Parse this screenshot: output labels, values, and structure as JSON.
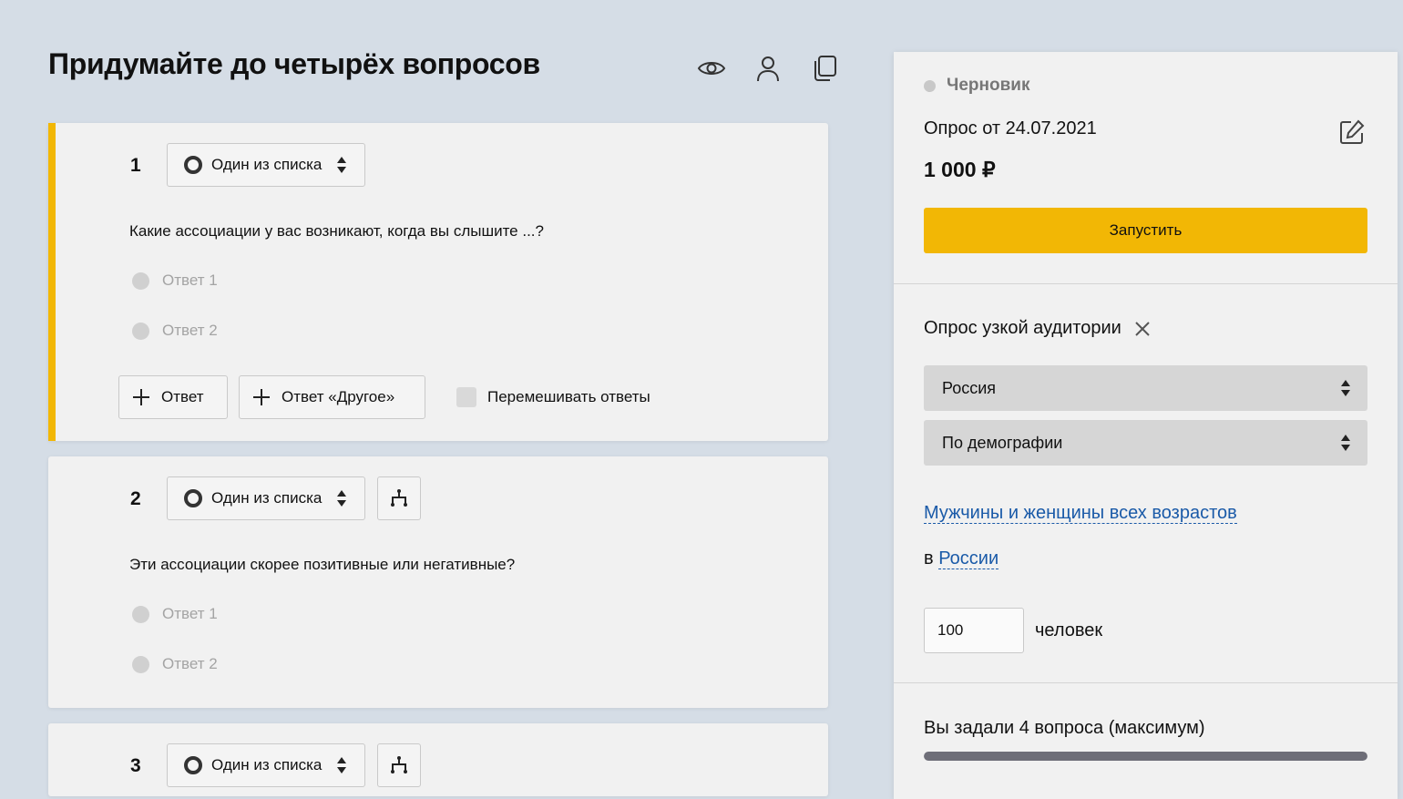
{
  "header": {
    "title": "Придумайте до четырёх вопросов",
    "icons": [
      "eye-icon",
      "user-icon",
      "copy-icon"
    ]
  },
  "questions": [
    {
      "number": "1",
      "type_label": "Один из списка",
      "text": "Какие ассоциации у вас возникают, когда вы слышите ...?",
      "answers": [
        "Ответ 1",
        "Ответ 2"
      ],
      "add_answer_label": "Ответ",
      "add_other_label": "Ответ «Другое»",
      "shuffle_label": "Перемешивать ответы"
    },
    {
      "number": "2",
      "type_label": "Один из списка",
      "text": "Эти ассоциации скорее позитивные или негативные?",
      "answers": [
        "Ответ 1",
        "Ответ 2"
      ]
    },
    {
      "number": "3",
      "type_label": "Один из списка"
    }
  ],
  "sidebar": {
    "status": "Черновик",
    "survey_name": "Опрос от 24.07.2021",
    "price": "1 000 ₽",
    "launch_label": "Запустить",
    "audience_title": "Опрос узкой аудитории",
    "region_select": "Россия",
    "targeting_select": "По демографии",
    "demographic_link": "Мужчины и женщины всех возрастов",
    "location_prefix": "в",
    "location_link": "России",
    "respondents_value": "100",
    "respondents_unit": "человек",
    "questions_asked": "Вы задали 4 вопроса (максимум)",
    "questions_progress": 1.0
  },
  "colors": {
    "accent": "#f2b705",
    "background": "#d5dde6",
    "link": "#1a5aa8"
  }
}
